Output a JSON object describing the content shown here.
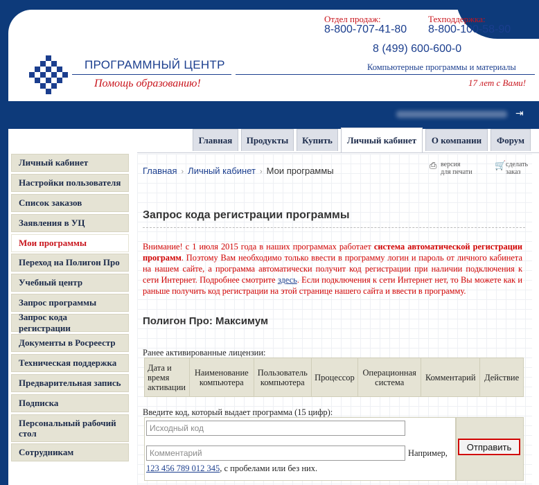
{
  "header": {
    "brand_name": "ПРОГРАММНЫЙ ЦЕНТР",
    "slogan": "Помощь образованию!",
    "sales_label": "Отдел продаж:",
    "sales_phone": "8-800-707-41-80",
    "support_label": "Техподдержка:",
    "support_phone": "8-800-100-58-90",
    "moscow_phone": "8 (499) 600-600-0",
    "tagline": "Компьютерные программы и материалы",
    "years": "17 лет с Вами!"
  },
  "userbar": {
    "logout_icon": "logout-icon"
  },
  "tabs": [
    {
      "label": "Главная"
    },
    {
      "label": "Продукты"
    },
    {
      "label": "Купить"
    },
    {
      "label": "Личный кабинет"
    },
    {
      "label": "О компании"
    },
    {
      "label": "Форум"
    }
  ],
  "sidebar": {
    "items": [
      {
        "label": "Личный кабинет"
      },
      {
        "label": "Настройки пользователя"
      },
      {
        "label": "Список заказов"
      },
      {
        "label": "Заявления в УЦ"
      },
      {
        "label": "Мои программы"
      },
      {
        "label": "Переход на Полигон Про"
      },
      {
        "label": "Учебный центр"
      },
      {
        "label": "Запрос программы"
      },
      {
        "label": "Запрос кода регистрации"
      },
      {
        "label": "Документы в Росреестр"
      },
      {
        "label": "Техническая поддержка"
      },
      {
        "label": "Предварительная запись"
      },
      {
        "label": "Подписка"
      },
      {
        "label": "Персональный рабочий стол"
      },
      {
        "label": "Сотрудникам"
      }
    ]
  },
  "breadcrumb": [
    "Главная",
    "Личный кабинет",
    "Мои программы"
  ],
  "tools": {
    "print_line1": "версия",
    "print_line2": "для печати",
    "order_line1": "сделать",
    "order_line2": "заказ"
  },
  "main": {
    "title": "Запрос кода регистрации программы",
    "notice_p1": "Внимание! с 1 июля 2015 года в наших программах работает ",
    "notice_bold": "система автоматической регистрации программ",
    "notice_p2": ". Поэтому Вам необходимо только ввести в программу логин и пароль от личного кабинета на нашем сайте, а программа автоматически получит код регистрации при наличии подключения к сети Интернет. Подробнее смотрите ",
    "notice_link": "здесь",
    "notice_p3": ". Если подключения к сети Интернет нет, то Вы можете как и раньше получить код регистрации на этой странице нашего сайта и ввести в программу.",
    "product_title": "Полигон Про: Максимум",
    "licenses_label": "Ранее активированные лицензии:",
    "license_columns": [
      "Дата и время активации",
      "Наименование компьютера",
      "Пользователь компьютера",
      "Процессор",
      "Операционная система",
      "Комментарий",
      "Действие"
    ],
    "code_label": "Введите код, который выдает программа (15 цифр):",
    "code_placeholder": "Исходный код",
    "comment_placeholder": "Комментарий",
    "example_label": "Например,",
    "example_number": "123 456 789 012 345",
    "example_suffix": ", с пробелами или без них.",
    "submit_label": "Отправить"
  }
}
